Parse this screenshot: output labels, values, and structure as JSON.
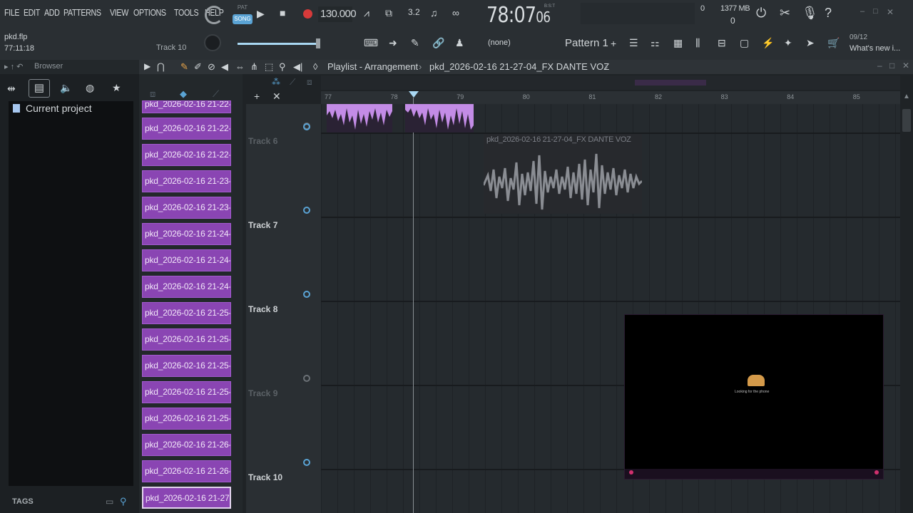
{
  "menu": [
    "FILE",
    "EDIT",
    "ADD",
    "PATTERNS",
    "VIEW",
    "OPTIONS",
    "TOOLS",
    "HELP"
  ],
  "transport": {
    "mode_pat": "PAT",
    "mode_song": "SONG",
    "tempo": "130.000",
    "time_main": "78:07",
    "time_sub": "06",
    "time_unit": "B:S:T"
  },
  "status": {
    "cpu_top": "0",
    "memory": "1377 MB",
    "poly": "0"
  },
  "hint": {
    "date": "09/12",
    "text": "What's new i..."
  },
  "project": {
    "file": "pkd.flp",
    "time": "77:11:18",
    "track_label": "Track 10"
  },
  "toolbar2": {
    "snap": "(none)",
    "pattern": "Pattern 1"
  },
  "browser": {
    "title": "Browser",
    "folder": "Current project",
    "tags": "TAGS"
  },
  "playlist": {
    "title": "Playlist - Arrangement",
    "clip_path": "pkd_2026-02-16 21-27-04_FX DANTE VOZ"
  },
  "ruler": [
    "77",
    "78",
    "79",
    "80",
    "81",
    "82",
    "83",
    "84",
    "85"
  ],
  "patterns": [
    "pkd_2026-02-16 21-22-...",
    "pkd_2026-02-16 21-22-...",
    "pkd_2026-02-16 21-22-...",
    "pkd_2026-02-16 21-23-...",
    "pkd_2026-02-16 21-23-...",
    "pkd_2026-02-16 21-24-...",
    "pkd_2026-02-16 21-24-...",
    "pkd_2026-02-16 21-24-...",
    "pkd_2026-02-16 21-25-...",
    "pkd_2026-02-16 21-25-...",
    "pkd_2026-02-16 21-25-...",
    "pkd_2026-02-16 21-25-...",
    "pkd_2026-02-16 21-25-...",
    "pkd_2026-02-16 21-26-...",
    "pkd_2026-02-16 21-26-...",
    "pkd_2026-02-16 21-27-..."
  ],
  "tracks": [
    {
      "name": "Track 6",
      "dim": true
    },
    {
      "name": "Track 7",
      "dim": false
    },
    {
      "name": "Track 8",
      "dim": false
    },
    {
      "name": "Track 9",
      "dim": true
    },
    {
      "name": "Track 10",
      "dim": false
    }
  ],
  "clip": {
    "name": "pkd_2026-02-16 21-27-04_FX DANTE VOZ"
  },
  "popup": {
    "text": "Looking for the phone"
  }
}
